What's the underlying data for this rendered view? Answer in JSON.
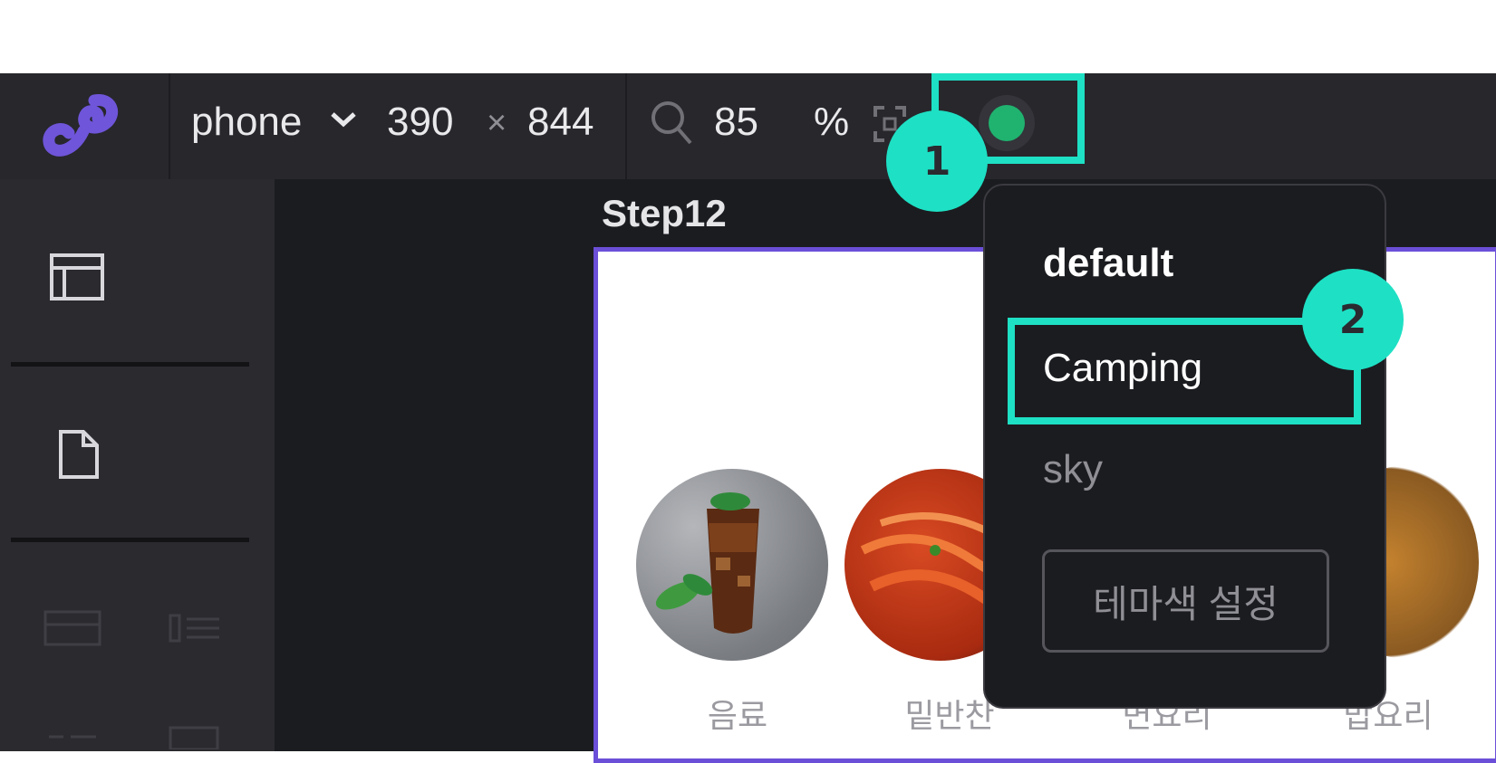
{
  "toolbar": {
    "device": "phone",
    "width": "390",
    "times": "×",
    "height": "844",
    "zoom": "85",
    "zoom_unit": "%",
    "theme_color": "#1fb36f"
  },
  "canvas": {
    "step_label": "Step12",
    "categories": [
      {
        "label": "음료"
      },
      {
        "label": "밑반찬"
      },
      {
        "label": "면요리"
      },
      {
        "label": "밥요리"
      }
    ]
  },
  "theme_menu": {
    "items": [
      "default",
      "Camping",
      "sky"
    ],
    "setting_button": "테마색 설정"
  },
  "annotations": {
    "badge_1": "1",
    "badge_2": "2",
    "highlight_color": "#1ee0c4"
  }
}
